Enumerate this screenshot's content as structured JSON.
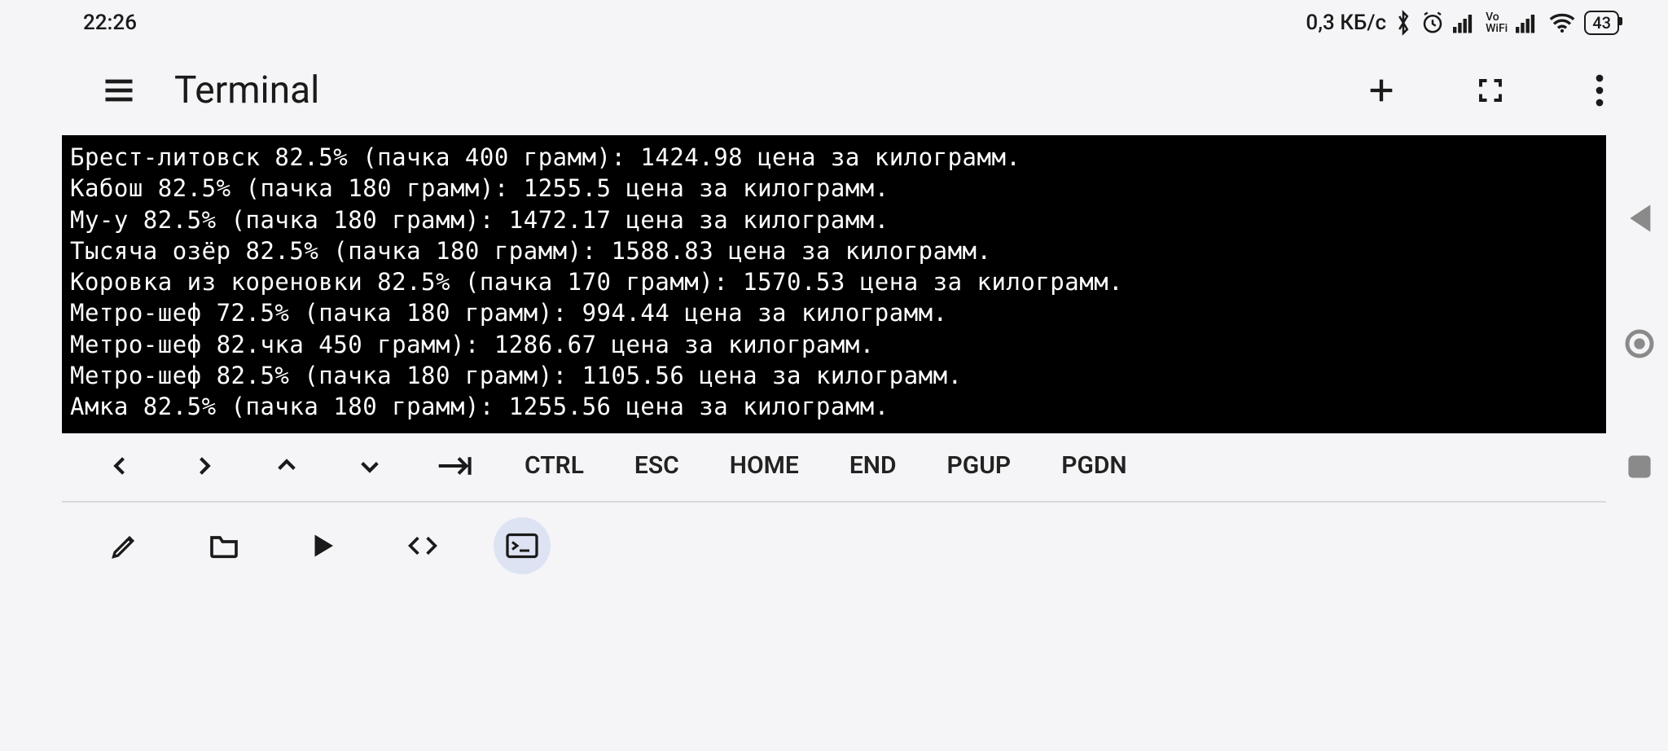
{
  "status": {
    "time": "22:26",
    "data_rate": "0,3 КБ/с",
    "battery": "43",
    "vowifi": "Vo\nWiFi"
  },
  "header": {
    "title": "Terminal"
  },
  "terminal": {
    "lines": [
      "Брест-литовск 82.5% (пачка 400 грамм): 1424.98 цена за килограмм.",
      "Кабош 82.5% (пачка 180 грамм): 1255.5 цена за килограмм.",
      "Му-у 82.5% (пачка 180 грамм): 1472.17 цена за килограмм.",
      "Тысяча озёр 82.5% (пачка 180 грамм): 1588.83 цена за килограмм.",
      "Коровка из кореновки 82.5% (пачка 170 грамм): 1570.53 цена за килограмм.",
      "Метро-шеф 72.5% (пачка 180 грамм): 994.44 цена за килограмм.",
      "Метро-шеф 82.чка 450 грамм): 1286.67 цена за килограмм.",
      "Метро-шеф 82.5% (пачка 180 грамм): 1105.56 цена за килограмм.",
      "Амка 82.5% (пачка 180 грамм): 1255.56 цена за килограмм."
    ]
  },
  "keys": {
    "ctrl": "CTRL",
    "esc": "ESC",
    "home": "HOME",
    "end": "END",
    "pgup": "PGUP",
    "pgdn": "PGDN"
  }
}
